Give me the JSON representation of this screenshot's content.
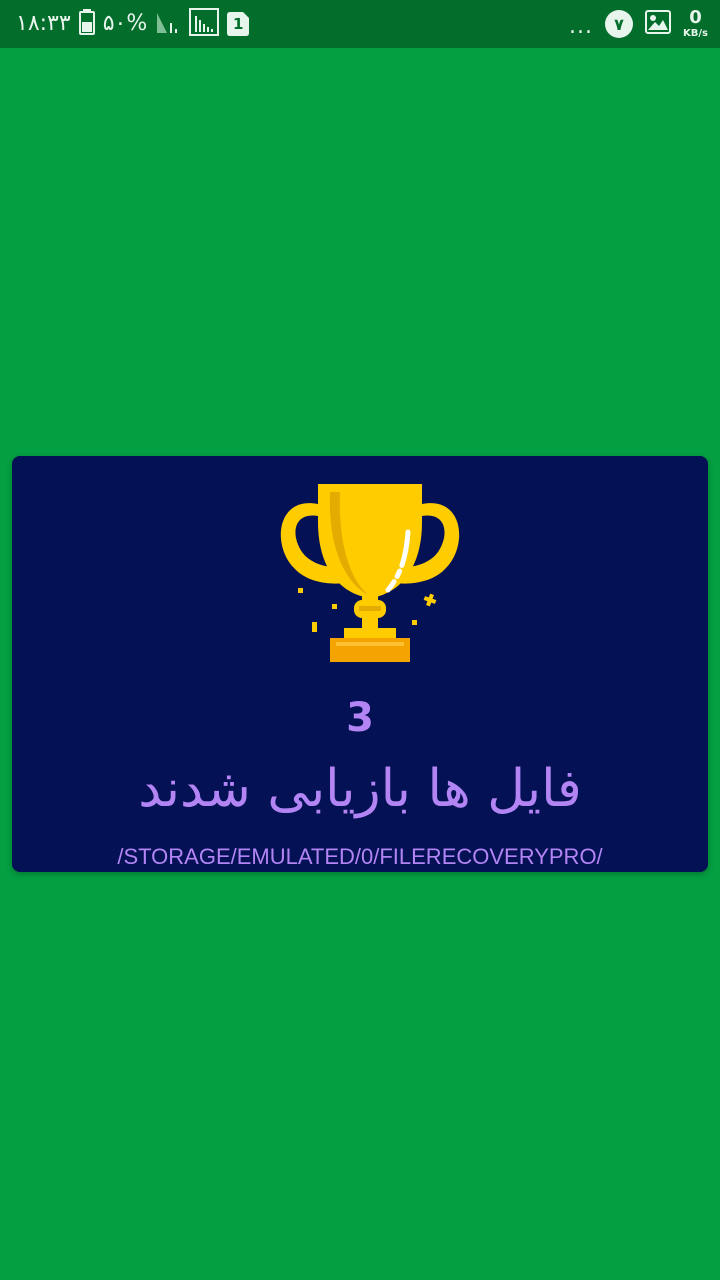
{
  "status_bar": {
    "time": "۱۸:۳۳",
    "battery": "۵۰%",
    "sim_badge": "1",
    "dots": "...",
    "notification_count": "۷",
    "net_speed_value": "0",
    "net_speed_unit": "KB/s",
    "icons": [
      "battery-icon",
      "signal-icon",
      "data-activity-icon",
      "sim-icon",
      "gallery-icon"
    ]
  },
  "result": {
    "icon": "trophy-icon",
    "count": "3",
    "message": "فایل ها بازیابی شدند",
    "path": "/STORAGE/EMULATED/0/FILERECOVERYPRO/"
  },
  "colors": {
    "background": "#049f41",
    "status_bar": "#036e2b",
    "card": "#041154",
    "text_accent": "#b284f4",
    "trophy_gold": "#ffcc00",
    "trophy_base": "#f5a300"
  }
}
